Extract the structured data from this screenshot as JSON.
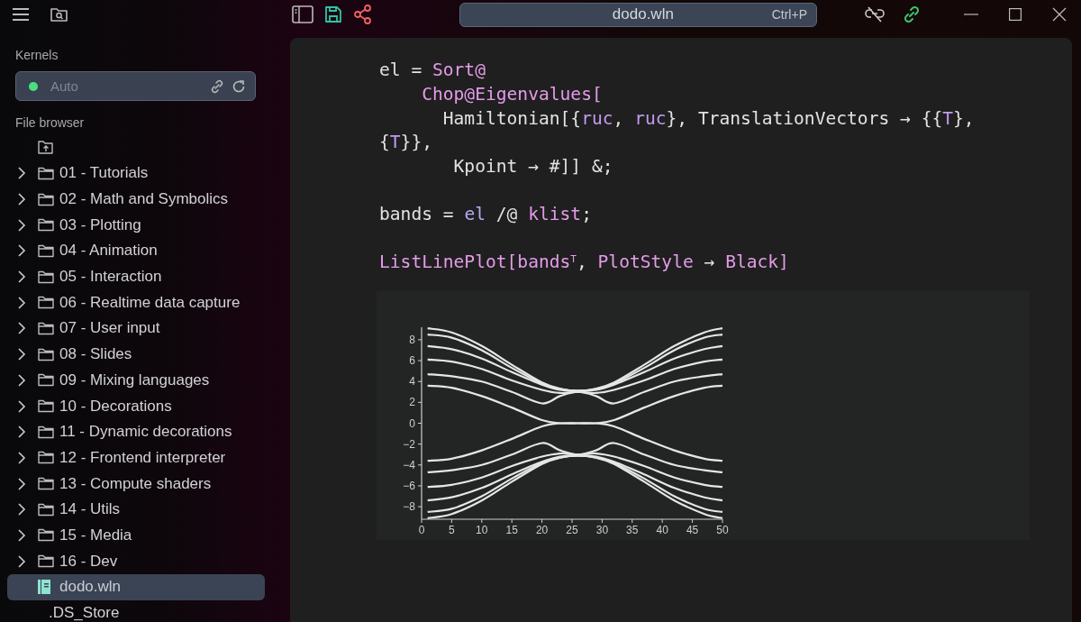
{
  "title_bar": {
    "search": {
      "value": "dodo.wln",
      "shortcut": "Ctrl+P"
    }
  },
  "sidebar": {
    "kernels_label": "Kernels",
    "kernel": {
      "name": "Auto"
    },
    "files_label": "File browser",
    "items": [
      {
        "kind": "folder",
        "label": "01 - Tutorials",
        "expanded": false,
        "selected": false
      },
      {
        "kind": "folder",
        "label": "02 - Math and Symbolics",
        "expanded": false,
        "selected": false
      },
      {
        "kind": "folder",
        "label": "03 - Plotting",
        "expanded": false,
        "selected": false
      },
      {
        "kind": "folder",
        "label": "04 - Animation",
        "expanded": false,
        "selected": false
      },
      {
        "kind": "folder",
        "label": "05 - Interaction",
        "expanded": false,
        "selected": false
      },
      {
        "kind": "folder",
        "label": "06 - Realtime data capture",
        "expanded": false,
        "selected": false
      },
      {
        "kind": "folder",
        "label": "07 - User input",
        "expanded": false,
        "selected": false
      },
      {
        "kind": "folder",
        "label": "08 - Slides",
        "expanded": false,
        "selected": false
      },
      {
        "kind": "folder",
        "label": "09 - Mixing languages",
        "expanded": false,
        "selected": false
      },
      {
        "kind": "folder",
        "label": "10 - Decorations",
        "expanded": false,
        "selected": false
      },
      {
        "kind": "folder",
        "label": "11 - Dynamic decorations",
        "expanded": false,
        "selected": false
      },
      {
        "kind": "folder",
        "label": "12 - Frontend interpreter",
        "expanded": false,
        "selected": false
      },
      {
        "kind": "folder",
        "label": "13 - Compute shaders",
        "expanded": false,
        "selected": false
      },
      {
        "kind": "folder",
        "label": "14 - Utils",
        "expanded": false,
        "selected": false
      },
      {
        "kind": "folder",
        "label": "15 - Media",
        "expanded": false,
        "selected": false
      },
      {
        "kind": "folder",
        "label": "16 - Dev",
        "expanded": false,
        "selected": false
      },
      {
        "kind": "notebook",
        "label": "dodo.wln",
        "selected": true
      },
      {
        "kind": "file",
        "label": ".DS_Store",
        "selected": false
      }
    ]
  },
  "notebook": {
    "cells": [
      {
        "lines": [
          [
            {
              "kind": "plain",
              "text": "el = "
            },
            {
              "kind": "builtin",
              "text": "Sort@"
            }
          ],
          [
            {
              "kind": "builtin",
              "text": "    Chop@Eigenvalues["
            }
          ],
          [
            {
              "kind": "plain",
              "text": "      Hamiltonian[{"
            },
            {
              "kind": "variable",
              "text": "ruc"
            },
            {
              "kind": "plain",
              "text": ", "
            },
            {
              "kind": "variable",
              "text": "ruc"
            },
            {
              "kind": "plain",
              "text": "}, TranslationVectors → {{"
            },
            {
              "kind": "variable",
              "text": "T"
            },
            {
              "kind": "plain",
              "text": "},"
            }
          ],
          [
            {
              "kind": "plain",
              "text": "{"
            },
            {
              "kind": "variable",
              "text": "T"
            },
            {
              "kind": "plain",
              "text": "}},"
            }
          ],
          [
            {
              "kind": "plain",
              "text": "       Kpoint → #]] &;"
            }
          ]
        ]
      },
      {
        "lines": [
          [
            {
              "kind": "plain",
              "text": "bands = "
            },
            {
              "kind": "local",
              "text": "el"
            },
            {
              "kind": "plain",
              "text": " /@ "
            },
            {
              "kind": "builtin",
              "text": "klist"
            },
            {
              "kind": "plain",
              "text": ";"
            }
          ]
        ]
      },
      {
        "lines": [
          [
            {
              "kind": "builtin",
              "text": "ListLinePlot[bands$^{T}$"
            },
            {
              "kind": "plain",
              "text": ", "
            },
            {
              "kind": "builtin",
              "text": "PlotStyle"
            },
            {
              "kind": "plain",
              "text": " → "
            },
            {
              "kind": "builtin",
              "text": "Black]"
            }
          ]
        ],
        "output": {
          "chart_data": {
            "type": "line",
            "x": [
              1,
              5,
              10,
              15,
              20,
              23,
              26,
              29,
              32,
              37,
              42,
              47,
              50
            ],
            "xlim": [
              0,
              50
            ],
            "ylim": [
              -9.2,
              9.2
            ],
            "xticks": [
              0,
              5,
              10,
              15,
              20,
              25,
              30,
              35,
              40,
              45,
              50
            ],
            "yticks": [
              -8,
              -6,
              -4,
              -2,
              0,
              2,
              4,
              6,
              8
            ],
            "series": [
              {
                "color": "#e6e6e6",
                "values": [
                  -9.1,
                  -8.7,
                  -7.4,
                  -5.6,
                  -3.9,
                  -3.3,
                  -3.1,
                  -3.3,
                  -3.9,
                  -5.6,
                  -7.4,
                  -8.7,
                  -9.1
                ]
              },
              {
                "color": "#e6e6e6",
                "values": [
                  -8.5,
                  -8.2,
                  -7.0,
                  -5.3,
                  -3.8,
                  -3.3,
                  -3.1,
                  -3.3,
                  -3.8,
                  -5.3,
                  -7.0,
                  -8.2,
                  -8.5
                ]
              },
              {
                "color": "#e6e6e6",
                "values": [
                  -7.4,
                  -7.1,
                  -6.2,
                  -4.9,
                  -3.7,
                  -3.2,
                  -3.1,
                  -3.2,
                  -3.7,
                  -4.9,
                  -6.2,
                  -7.1,
                  -7.4
                ]
              },
              {
                "color": "#e6e6e6",
                "values": [
                  -6.1,
                  -5.9,
                  -5.2,
                  -4.1,
                  -3.2,
                  -2.9,
                  -3.0,
                  -2.9,
                  -3.2,
                  -4.1,
                  -5.2,
                  -5.9,
                  -6.1
                ]
              },
              {
                "color": "#e6e6e6",
                "values": [
                  -4.7,
                  -4.5,
                  -4.0,
                  -3.0,
                  -1.9,
                  -2.6,
                  -3.0,
                  -2.6,
                  -1.9,
                  -3.0,
                  -4.0,
                  -4.5,
                  -4.7
                ]
              },
              {
                "color": "#e6e6e6",
                "values": [
                  -3.6,
                  -3.4,
                  -2.6,
                  -1.5,
                  -0.3,
                  0,
                  0,
                  0,
                  -0.3,
                  -1.5,
                  -2.6,
                  -3.4,
                  -3.6
                ]
              },
              {
                "color": "#e6e6e6",
                "values": [
                  3.6,
                  3.4,
                  2.6,
                  1.5,
                  0.3,
                  0,
                  0,
                  0,
                  0.3,
                  1.5,
                  2.6,
                  3.4,
                  3.6
                ]
              },
              {
                "color": "#e6e6e6",
                "values": [
                  4.7,
                  4.5,
                  4.0,
                  3.0,
                  1.9,
                  2.6,
                  3.0,
                  2.6,
                  1.9,
                  3.0,
                  4.0,
                  4.5,
                  4.7
                ]
              },
              {
                "color": "#e6e6e6",
                "values": [
                  6.1,
                  5.9,
                  5.2,
                  4.1,
                  3.2,
                  2.9,
                  3.0,
                  2.9,
                  3.2,
                  4.1,
                  5.2,
                  5.9,
                  6.1
                ]
              },
              {
                "color": "#e6e6e6",
                "values": [
                  7.4,
                  7.1,
                  6.2,
                  4.9,
                  3.7,
                  3.2,
                  3.1,
                  3.2,
                  3.7,
                  4.9,
                  6.2,
                  7.1,
                  7.4
                ]
              },
              {
                "color": "#e6e6e6",
                "values": [
                  8.5,
                  8.2,
                  7.0,
                  5.3,
                  3.8,
                  3.3,
                  3.1,
                  3.3,
                  3.8,
                  5.3,
                  7.0,
                  8.2,
                  8.5
                ]
              },
              {
                "color": "#e6e6e6",
                "values": [
                  9.1,
                  8.7,
                  7.4,
                  5.6,
                  3.9,
                  3.3,
                  3.1,
                  3.3,
                  3.9,
                  5.6,
                  7.4,
                  8.7,
                  9.1
                ]
              }
            ]
          }
        }
      }
    ]
  }
}
